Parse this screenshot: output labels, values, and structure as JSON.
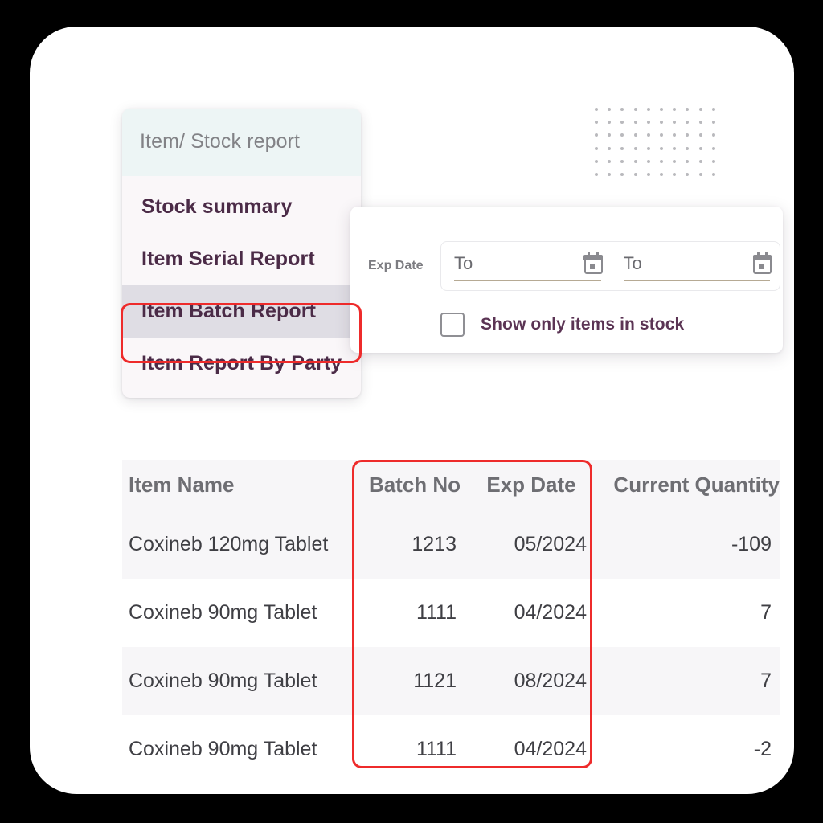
{
  "report_menu": {
    "header_title": "Item/ Stock report",
    "items": [
      {
        "label": "Stock summary",
        "selected": false
      },
      {
        "label": "Item Serial Report",
        "selected": false
      },
      {
        "label": "Item Batch Report",
        "selected": true
      },
      {
        "label": "Item Report By Party",
        "selected": false
      }
    ]
  },
  "filter_panel": {
    "exp_date_label": "Exp Date",
    "date_from": {
      "value": "",
      "placeholder": "To",
      "icon": "calendar-icon"
    },
    "date_to": {
      "value": "",
      "placeholder": "To",
      "icon": "calendar-icon"
    },
    "checkbox": {
      "label": "Show only items in stock",
      "checked": false
    }
  },
  "table": {
    "columns": [
      "Item Name",
      "Batch No",
      "Exp Date",
      "Current Quantity"
    ],
    "rows": [
      {
        "item_name": "Coxineb 120mg Tablet",
        "batch_no": "1213",
        "exp_date": "05/2024",
        "current_quantity": "-109"
      },
      {
        "item_name": "Coxineb 90mg Tablet",
        "batch_no": "1111",
        "exp_date": "04/2024",
        "current_quantity": "7"
      },
      {
        "item_name": "Coxineb 90mg Tablet",
        "batch_no": "1121",
        "exp_date": "08/2024",
        "current_quantity": "7"
      },
      {
        "item_name": "Coxineb 90mg Tablet",
        "batch_no": "1111",
        "exp_date": "04/2024",
        "current_quantity": "-2"
      }
    ]
  },
  "annotations": {
    "highlight_color": "#ee2b2b",
    "menu_highlight_target": "Item Batch Report",
    "table_highlight_target": "Batch No / Exp Date columns"
  },
  "theme": {
    "menu_header_bg": "#edf5f5",
    "menu_bg": "#faf7f9",
    "menu_text": "#4b2b47",
    "selected_row_bg": "#dfdde4",
    "table_header_text": "#6e6e73",
    "table_alt_row_bg": "#f7f6f8",
    "card_bg": "#ffffff",
    "canvas_bg": "#000000"
  }
}
